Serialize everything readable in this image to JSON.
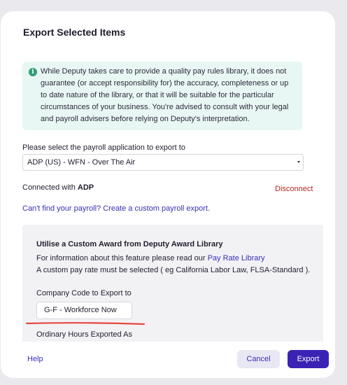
{
  "dialog": {
    "title": "Export Selected Items"
  },
  "info_notice": {
    "icon": "info-icon",
    "text": "While Deputy takes care to provide a quality pay rules library, it does not guarantee (or accept responsibility for) the accuracy, completeness or up to date nature of the library, or that it will be suitable for the particular circumstances of your business. You're advised to consult with your legal and payroll advisers before relying on Deputy's interpretation."
  },
  "payroll_select": {
    "label": "Please select the payroll application to export to",
    "value": "ADP (US) - WFN - Over The Air"
  },
  "connection": {
    "prefix": "Connected with",
    "provider": "ADP",
    "disconnect_label": "Disconnect"
  },
  "custom_payroll_link": "Can't find your payroll? Create a custom payroll export.",
  "award_panel": {
    "heading": "Utilise a Custom Award from Deputy Award Library",
    "info_prefix": "For information about this feature please read our",
    "info_link": "Pay Rate Library",
    "note": "A custom pay rate must be selected ( eg California Labor Law, FLSA-Standard ).",
    "company_code_label": "Company Code to Export to",
    "company_code_value": "G-F - Workforce Now",
    "ordinary_hours_label": "Ordinary Hours Exported As"
  },
  "footer": {
    "help_label": "Help",
    "cancel_label": "Cancel",
    "export_label": "Export"
  },
  "colors": {
    "accent": "#3a22b4",
    "link": "#3a2fb8",
    "danger": "#b3261e",
    "info_bg": "#e9f7f4",
    "highlight_underline": "#e5483f"
  }
}
